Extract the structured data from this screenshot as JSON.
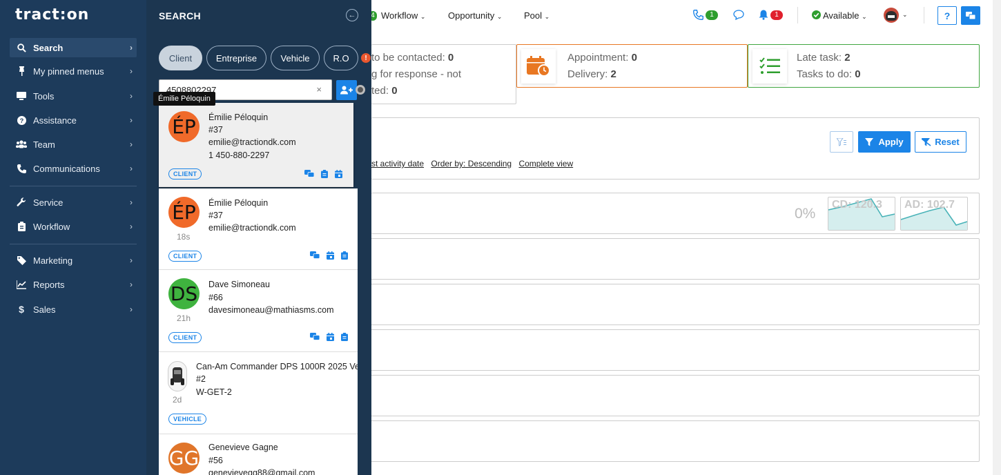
{
  "app": {
    "logo": "tract:on"
  },
  "sidebar": {
    "items": [
      {
        "label": "Search",
        "icon": "search-icon"
      },
      {
        "label": "My pinned menus",
        "icon": "pin-icon"
      },
      {
        "label": "Tools",
        "icon": "monitor-icon"
      },
      {
        "label": "Assistance",
        "icon": "question-icon"
      },
      {
        "label": "Team",
        "icon": "team-icon"
      },
      {
        "label": "Communications",
        "icon": "phone-icon"
      },
      {
        "label": "Service",
        "icon": "wrench-icon"
      },
      {
        "label": "Workflow",
        "icon": "clipboard-icon"
      },
      {
        "label": "Marketing",
        "icon": "tag-icon"
      },
      {
        "label": "Reports",
        "icon": "chart-icon"
      },
      {
        "label": "Sales",
        "icon": "dollar-icon"
      }
    ]
  },
  "search": {
    "title": "SEARCH",
    "tabs": [
      "Client",
      "Entreprise",
      "Vehicle",
      "R.O"
    ],
    "warning": "!",
    "query": "4508802297",
    "clear": "×",
    "tooltip": "Émilie Péloquin",
    "results": [
      {
        "initials": "ÉP",
        "name": "Émilie Péloquin",
        "number": "#37",
        "email": "emilie@tractiondk.com",
        "phone": "1 450-880-2297",
        "time": "",
        "badge": "CLIENT"
      },
      {
        "initials": "ÉP",
        "name": "Émilie Péloquin",
        "number": "#37",
        "email": "emilie@tractiondk.com",
        "time": "18s",
        "badge": "CLIENT"
      },
      {
        "initials": "DS",
        "name": "Dave Simoneau",
        "number": "#66",
        "email": "davesimoneau@mathiasms.com",
        "time": "21h",
        "badge": "CLIENT"
      },
      {
        "initials": "",
        "name": "Can-Am Commander DPS 1000R 2025 Ve",
        "number": "#2",
        "email": "W-GET-2",
        "time": "2d",
        "badge": "VEHICLE"
      },
      {
        "initials": "GG",
        "name": "Genevieve Gagne",
        "number": "#56",
        "email": "genevievegg88@gmail.com",
        "time": "",
        "badge": ""
      }
    ]
  },
  "topbar": {
    "workflow_badge": "4",
    "workflow": "Workflow",
    "opportunity": "Opportunity",
    "pool": "Pool",
    "phone_count": "1",
    "notif_count": "1",
    "status": "Available",
    "help": "?"
  },
  "stats": {
    "box1": {
      "line1": "to be contacted: ",
      "val1": "0",
      "line2": "g for response - not",
      "line3": "ted: ",
      "val3": "0"
    },
    "box2": {
      "line1": "Appointment: ",
      "val1": "0",
      "line2": "Delivery: ",
      "val2": "2"
    },
    "box3": {
      "line1": "Late task: ",
      "val1": "2",
      "line2": "Tasks to do: ",
      "val2": "0"
    }
  },
  "filters": {
    "apply": "Apply",
    "reset": "Reset",
    "links": [
      "st activity date",
      "Order by: Descending",
      "Complete view"
    ]
  },
  "metrics": {
    "percent": "0%",
    "cd": "CD: 120.3",
    "ad": "AD: 102.7"
  },
  "colors": {
    "primary": "#1b84e7",
    "sidebar": "#1d3b5b",
    "orange": "#e87722",
    "green": "#2e9e2e"
  }
}
